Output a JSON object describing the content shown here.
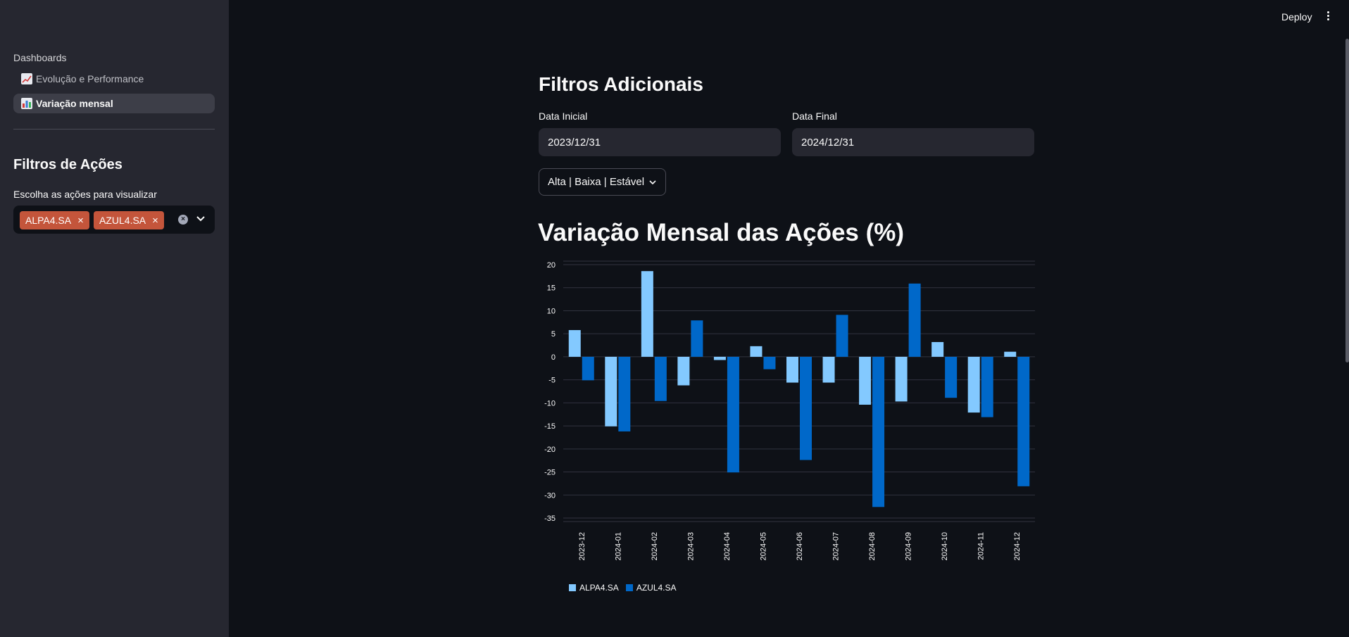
{
  "sidebar": {
    "nav_heading": "Dashboards",
    "items": [
      {
        "label": "Evolução e Performance",
        "icon": "chart-increasing-icon",
        "active": false
      },
      {
        "label": "Variação mensal",
        "icon": "bar-chart-icon",
        "active": true
      }
    ],
    "filters_title": "Filtros de Ações",
    "select_label": "Escolha as ações para visualizar",
    "selected_tags": [
      "ALPA4.SA",
      "AZUL4.SA"
    ]
  },
  "header": {
    "deploy_label": "Deploy"
  },
  "main": {
    "filters_title": "Filtros Adicionais",
    "start_date_label": "Data Inicial",
    "start_date_value": "2023/12/31",
    "end_date_label": "Data Final",
    "end_date_value": "2024/12/31",
    "trend_dropdown_label": "Alta | Baixa | Estável",
    "chart_title": "Variação Mensal das Ações (%)"
  },
  "colors": {
    "accent_tag": "#c4553b",
    "series_alpa": "#83c9ff",
    "series_azul": "#0068c9"
  },
  "chart_data": {
    "type": "bar",
    "categories": [
      "2023-12",
      "2024-01",
      "2024-02",
      "2024-03",
      "2024-04",
      "2024-05",
      "2024-06",
      "2024-07",
      "2024-08",
      "2024-09",
      "2024-10",
      "2024-11",
      "2024-12"
    ],
    "series": [
      {
        "name": "ALPA4.SA",
        "color": "#83c9ff",
        "values": [
          5.8,
          -15.1,
          18.6,
          -6.2,
          -0.7,
          2.3,
          -5.6,
          -5.6,
          -10.4,
          -9.7,
          3.2,
          -12.1,
          1.1
        ]
      },
      {
        "name": "AZUL4.SA",
        "color": "#0068c9",
        "values": [
          -5.1,
          -16.2,
          -9.6,
          7.9,
          -25.1,
          -2.7,
          -22.4,
          9.1,
          -32.6,
          15.9,
          -8.9,
          -13.1,
          -28.1
        ]
      }
    ],
    "ylim": [
      -35,
      20
    ],
    "yticks": [
      20,
      15,
      10,
      5,
      0,
      -5,
      -10,
      -15,
      -20,
      -25,
      -30,
      -35
    ],
    "grid": true,
    "legend": "bottom-left"
  }
}
